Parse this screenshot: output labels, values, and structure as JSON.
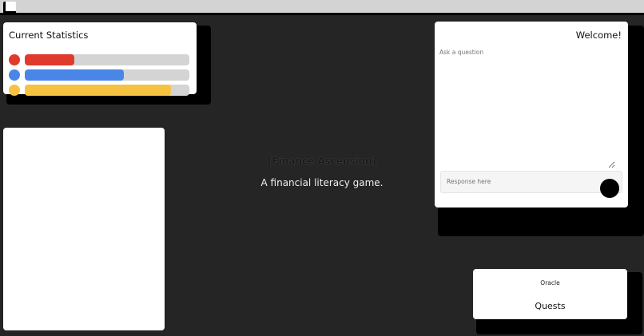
{
  "stats": {
    "title": "Current Statistics",
    "bars": [
      {
        "name": "red",
        "color": "#e03a2c",
        "fill": 0.3
      },
      {
        "name": "blue",
        "color": "#4a86e8",
        "fill": 0.6
      },
      {
        "name": "yellow",
        "color": "#f5c242",
        "fill": 0.89
      }
    ]
  },
  "center": {
    "title": "[Finance Ascension]",
    "subtitle": "A financial literacy game."
  },
  "chat": {
    "welcome": "Welcome!",
    "ask_placeholder": "Ask a question",
    "response_placeholder": "Response here"
  },
  "nav": {
    "oracle": "Oracle",
    "quests": "Quests"
  }
}
